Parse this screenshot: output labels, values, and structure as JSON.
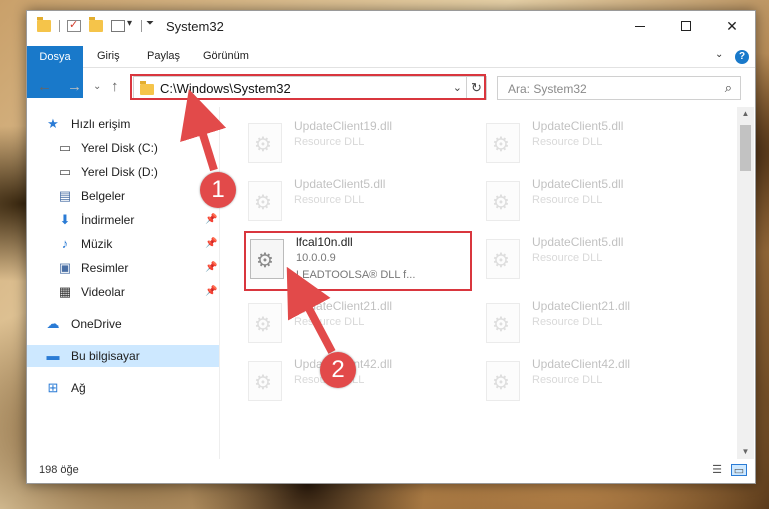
{
  "window": {
    "title": "System32"
  },
  "ribbon": {
    "tabs": [
      "Dosya",
      "Giriş",
      "Paylaş",
      "Görünüm"
    ],
    "help_label": "?"
  },
  "nav": {
    "address_path": "C:\\Windows\\System32",
    "search_placeholder": "Ara: System32"
  },
  "sidebar": {
    "items": [
      {
        "label": "Hızlı erişim",
        "icon": "star-icon",
        "pinned": false
      },
      {
        "label": "Yerel Disk (C:)",
        "icon": "drive-icon",
        "pinned": false
      },
      {
        "label": "Yerel Disk (D:)",
        "icon": "drive-icon",
        "pinned": false
      },
      {
        "label": "Belgeler",
        "icon": "documents-icon",
        "pinned": true
      },
      {
        "label": "İndirmeler",
        "icon": "download-icon",
        "pinned": true
      },
      {
        "label": "Müzik",
        "icon": "music-icon",
        "pinned": true
      },
      {
        "label": "Resimler",
        "icon": "pictures-icon",
        "pinned": true
      },
      {
        "label": "Videolar",
        "icon": "video-icon",
        "pinned": true
      },
      {
        "label": "OneDrive",
        "icon": "cloud-icon",
        "pinned": false
      },
      {
        "label": "Bu bilgisayar",
        "icon": "computer-icon",
        "pinned": false
      },
      {
        "label": "Ağ",
        "icon": "network-icon",
        "pinned": false
      }
    ]
  },
  "files": [
    {
      "name": "UpdateClient19.dll",
      "type": "Resource DLL",
      "faded": true
    },
    {
      "name": "UpdateClient5.dll",
      "type": "Resource DLL",
      "faded": true
    },
    {
      "name": "UpdateClient5.dll",
      "type": "Resource DLL",
      "faded": true
    },
    {
      "name": "UpdateClient5.dll",
      "type": "Resource DLL",
      "faded": true
    },
    {
      "name": "lfcal10n.dll",
      "version": "10.0.0.9",
      "type": "LEADTOOLSA® DLL f...",
      "faded": false
    },
    {
      "name": "UpdateClient5.dll",
      "type": "Resource DLL",
      "faded": true
    },
    {
      "name": "UpdateClient21.dll",
      "type": "Resource DLL",
      "faded": true
    },
    {
      "name": "UpdateClient21.dll",
      "type": "Resource DLL",
      "faded": true
    },
    {
      "name": "UpdateClient42.dll",
      "type": "Resource DLL",
      "faded": true
    },
    {
      "name": "UpdateClient42.dll",
      "type": "Resource DLL",
      "faded": true
    }
  ],
  "status": {
    "item_count": "198 öğe"
  },
  "annotations": {
    "marker_1": "1",
    "marker_2": "2",
    "color": "#d9363e"
  }
}
